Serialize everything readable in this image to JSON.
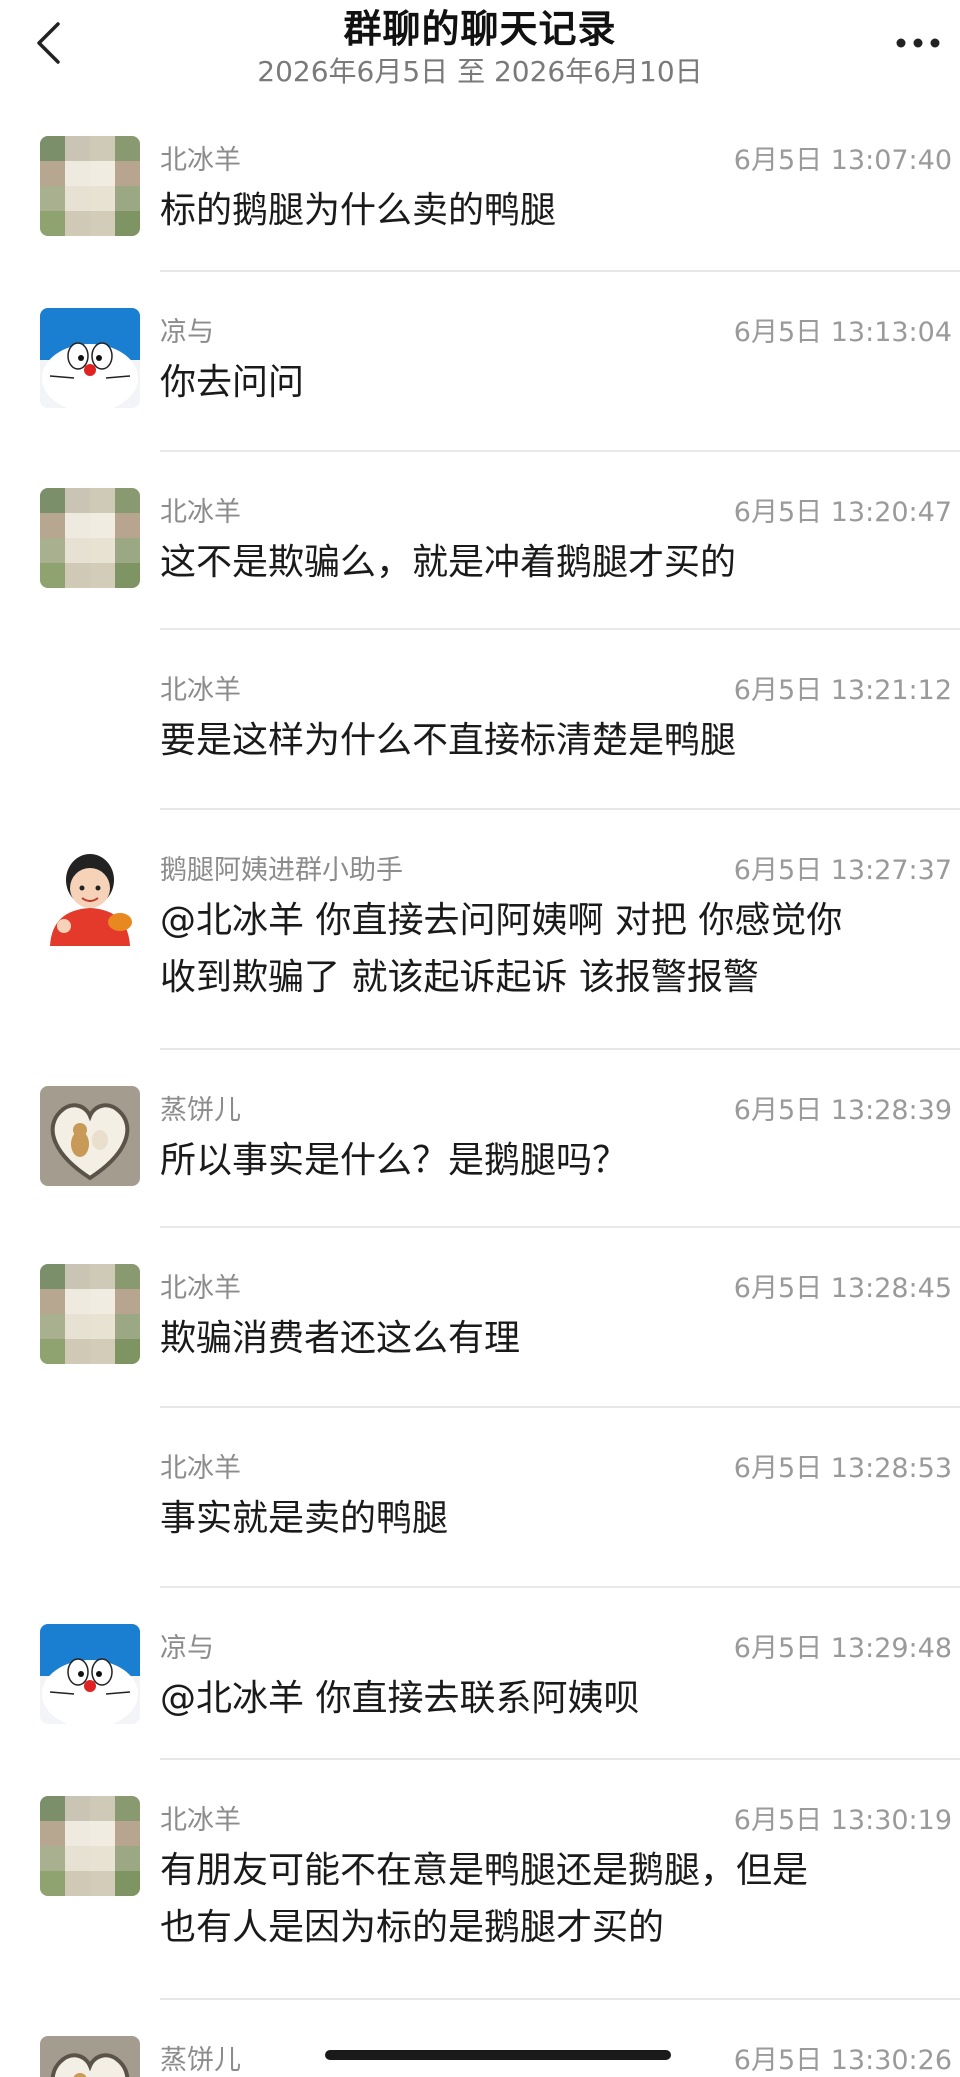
{
  "header": {
    "title": "群聊的聊天记录",
    "date_range": "2026年6月5日 至 2026年6月10日",
    "back_icon": "chevron-left-icon",
    "more_icon": "more-horizontal-icon"
  },
  "messages": [
    {
      "sender": "北冰羊",
      "time": "6月5日 13:07:40",
      "lines": [
        "标的鹅腿为什么卖的鸭腿"
      ],
      "avatar": "pixel"
    },
    {
      "sender": "凉与",
      "time": "6月5日 13:13:04",
      "lines": [
        "你去问问"
      ],
      "avatar": "doraemon"
    },
    {
      "sender": "北冰羊",
      "time": "6月5日 13:20:47",
      "lines": [
        "这不是欺骗么，就是冲着鹅腿才买的"
      ],
      "avatar": "pixel"
    },
    {
      "sender": "北冰羊",
      "time": "6月5日 13:21:12",
      "lines": [
        "要是这样为什么不直接标清楚是鸭腿"
      ],
      "avatar": "none"
    },
    {
      "sender": "鹅腿阿姨进群小助手",
      "time": "6月5日 13:27:37",
      "lines": [
        "@北冰羊 你直接去问阿姨啊 对把 你感觉你",
        "收到欺骗了 就该起诉起诉 该报警报警"
      ],
      "avatar": "cartoon"
    },
    {
      "sender": "蒸饼儿",
      "time": "6月5日 13:28:39",
      "lines": [
        "所以事实是什么？是鹅腿吗？"
      ],
      "avatar": "heart"
    },
    {
      "sender": "北冰羊",
      "time": "6月5日 13:28:45",
      "lines": [
        "欺骗消费者还这么有理"
      ],
      "avatar": "pixel"
    },
    {
      "sender": "北冰羊",
      "time": "6月5日 13:28:53",
      "lines": [
        "事实就是卖的鸭腿"
      ],
      "avatar": "none"
    },
    {
      "sender": "凉与",
      "time": "6月5日 13:29:48",
      "lines": [
        "@北冰羊 你直接去联系阿姨呗"
      ],
      "avatar": "doraemon"
    },
    {
      "sender": "北冰羊",
      "time": "6月5日 13:30:19",
      "lines": [
        "有朋友可能不在意是鸭腿还是鹅腿，但是",
        "也有人是因为标的是鹅腿才买的"
      ],
      "avatar": "pixel"
    },
    {
      "sender": "蒸饼儿",
      "time": "6月5日 13:30:26",
      "lines": [],
      "avatar": "heart"
    }
  ],
  "colors": {
    "separator": "#e8e8e8",
    "name": "#8c8c8c",
    "time": "#9a9a9a",
    "text": "#1a1a1a"
  }
}
